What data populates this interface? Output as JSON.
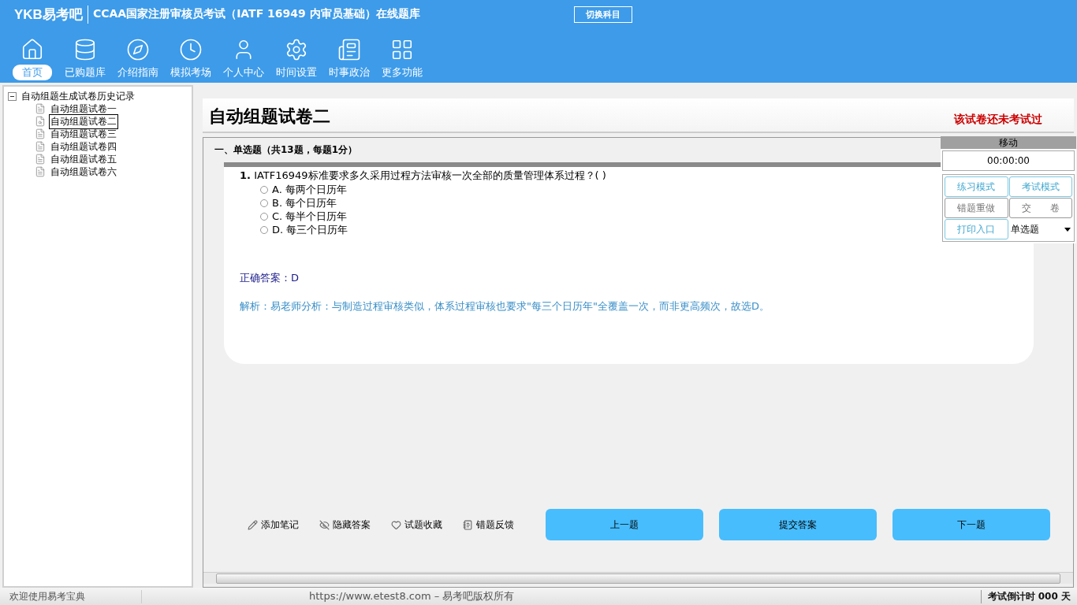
{
  "header": {
    "logo": "YKB易考吧",
    "title": "CCAA国家注册审核员考试（IATF 16949 内审员基础）在线题库",
    "switch_button": "切换科目"
  },
  "toolbar": [
    {
      "label": "首页",
      "selected": true
    },
    {
      "label": "已购题库",
      "selected": false
    },
    {
      "label": "介绍指南",
      "selected": false
    },
    {
      "label": "模拟考场",
      "selected": false
    },
    {
      "label": "个人中心",
      "selected": false
    },
    {
      "label": "时间设置",
      "selected": false
    },
    {
      "label": "时事政治",
      "selected": false
    },
    {
      "label": "更多功能",
      "selected": false
    }
  ],
  "tree": {
    "label": "自动组题生成试卷历史记录",
    "expanded": true,
    "children": [
      {
        "label": "自动组题试卷一",
        "selected": false
      },
      {
        "label": "自动组题试卷二",
        "selected": true
      },
      {
        "label": "自动组题试卷三",
        "selected": false
      },
      {
        "label": "自动组题试卷四",
        "selected": false
      },
      {
        "label": "自动组题试卷五",
        "selected": false
      },
      {
        "label": "自动组题试卷六",
        "selected": false
      }
    ]
  },
  "paper": {
    "title": "自动组题试卷二",
    "status": "该试卷还未考试过",
    "section": "一、单选题（共13题，每题1分）",
    "question": {
      "number": "1.",
      "text": "IATF16949标准要求多久采用过程方法审核一次全部的质量管理体系过程？(  )",
      "options": [
        {
          "label": "A. 每两个日历年",
          "selected": false
        },
        {
          "label": "B. 每个日历年",
          "selected": false
        },
        {
          "label": "C. 每半个日历年",
          "selected": false
        },
        {
          "label": "D. 每三个日历年",
          "selected": false
        }
      ],
      "answer": "正确答案：D",
      "analysis": "解析：易老师分析：与制造过程审核类似，体系过程审核也要求\"每三个日历年\"全覆盖一次，而非更高频次，故选D。"
    }
  },
  "actions": [
    "添加笔记",
    "隐藏答案",
    "试题收藏",
    "错题反馈"
  ],
  "nav_buttons": [
    "上一题",
    "提交答案",
    "下一题"
  ],
  "control_panel": {
    "title": "移动",
    "timer": "00:00:00",
    "buttons": [
      {
        "label": "练习模式",
        "disabled": false
      },
      {
        "label": "考试模式",
        "disabled": false
      },
      {
        "label": "错题重做",
        "disabled": true
      },
      {
        "label": "交　　卷",
        "disabled": true
      },
      {
        "label": "打印入口",
        "disabled": false
      }
    ],
    "type_select": "单选题"
  },
  "status_bar": {
    "welcome": "欢迎使用易考宝典",
    "copyright": "https://www.etest8.com – 易考吧版权所有",
    "countdown": "考试倒计时 000 天"
  }
}
